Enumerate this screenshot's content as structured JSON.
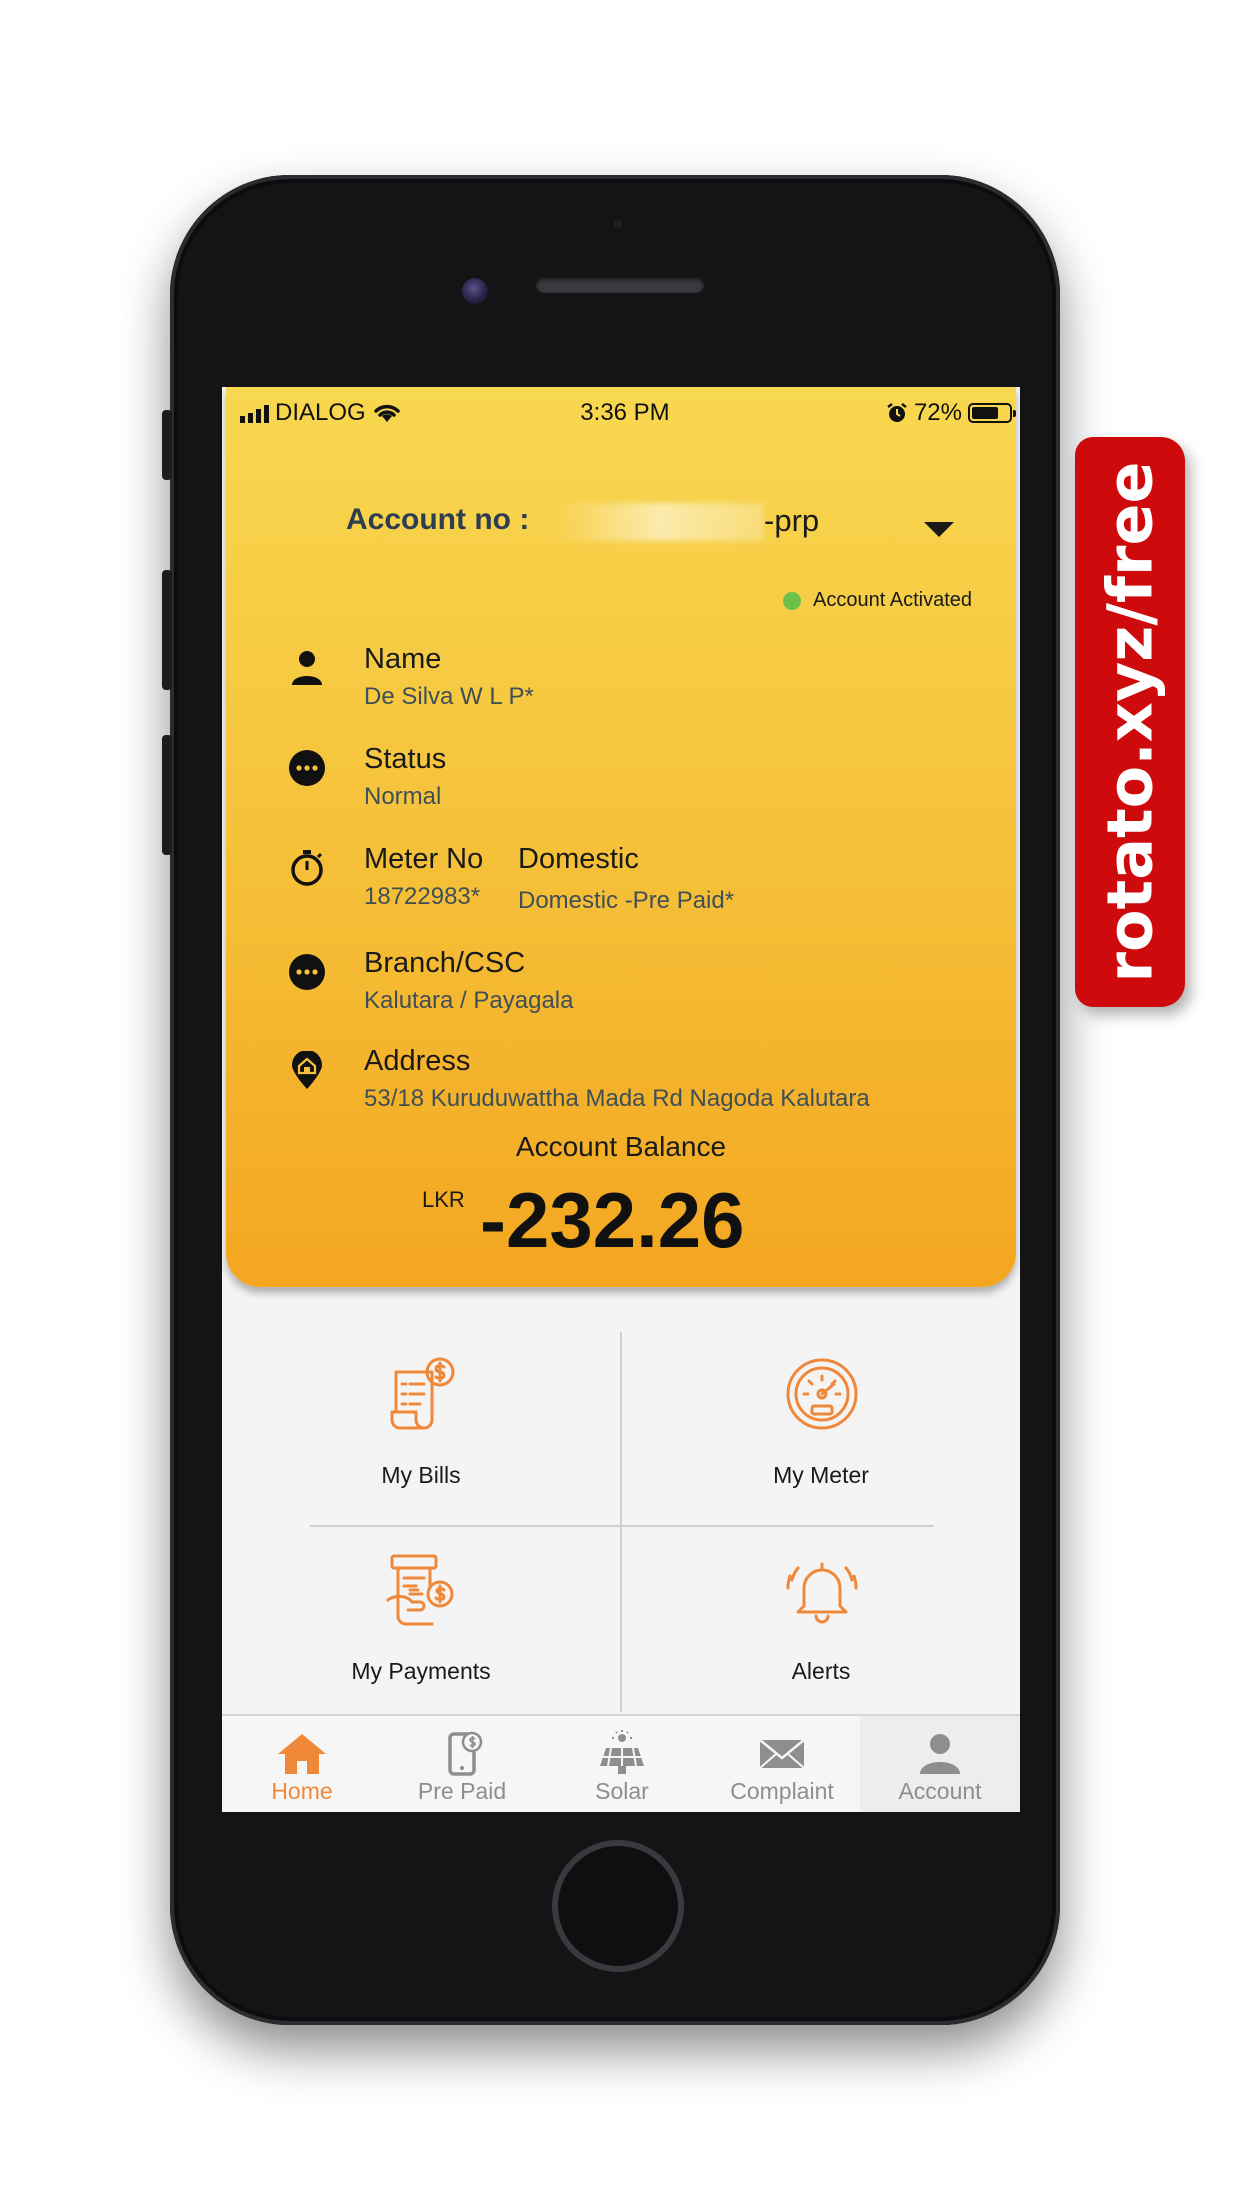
{
  "status_bar": {
    "carrier": "DIALOG",
    "time": "3:36 PM",
    "battery_pct": "72%",
    "battery_level": 0.72
  },
  "account": {
    "label": "Account  no :",
    "number_suffix": "-prp",
    "status": "Account Activated",
    "status_color": "#6cc14a"
  },
  "details": {
    "name_label": "Name",
    "name_value": "De Silva W L P*",
    "status_label": "Status",
    "status_value": "Normal",
    "meter_label": "Meter No",
    "meter_value": "18722983*",
    "tariff_label": "Domestic",
    "tariff_value": "Domestic -Pre Paid*",
    "branch_label": "Branch/CSC",
    "branch_value": "Kalutara / Payagala",
    "address_label": "Address",
    "address_value": "53/18 Kuruduwattha Mada Rd Nagoda Kalutara"
  },
  "balance": {
    "label": "Account Balance",
    "currency": "LKR",
    "value": "-232.26"
  },
  "menu": {
    "bills": "My Bills",
    "meter": "My Meter",
    "payments": "My Payments",
    "alerts": "Alerts"
  },
  "tabs": {
    "home": "Home",
    "prepaid": "Pre Paid",
    "solar": "Solar",
    "complaint": "Complaint",
    "account": "Account",
    "active": "home"
  },
  "colors": {
    "accent": "#f0883a",
    "header_top": "#f8d850",
    "header_bottom": "#f4a620",
    "watermark": "#cf0a0c"
  },
  "watermark": "rotato.xyz/free"
}
